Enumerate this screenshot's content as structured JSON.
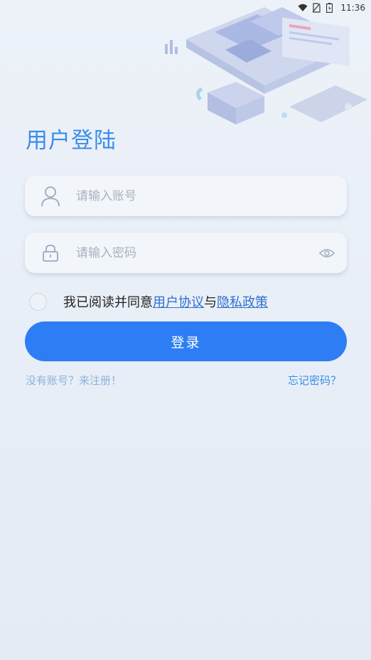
{
  "status_bar": {
    "time": "11:36",
    "icons": [
      "wifi-icon",
      "no-sim-icon",
      "battery-icon"
    ]
  },
  "login": {
    "title": "用户登陆",
    "account_placeholder": "请输入账号",
    "password_placeholder": "请输入密码",
    "agree_text": "我已阅读并同意",
    "user_agreement": "用户协议",
    "and_text": "与",
    "privacy_policy": "隐私政策",
    "submit_label": "登录",
    "register_link": "没有账号？来注册！",
    "forgot_link": "忘记密码？"
  },
  "colors": {
    "accent": "#2d7ef5",
    "title": "#3a8ee8",
    "link": "#2f6fd1"
  }
}
